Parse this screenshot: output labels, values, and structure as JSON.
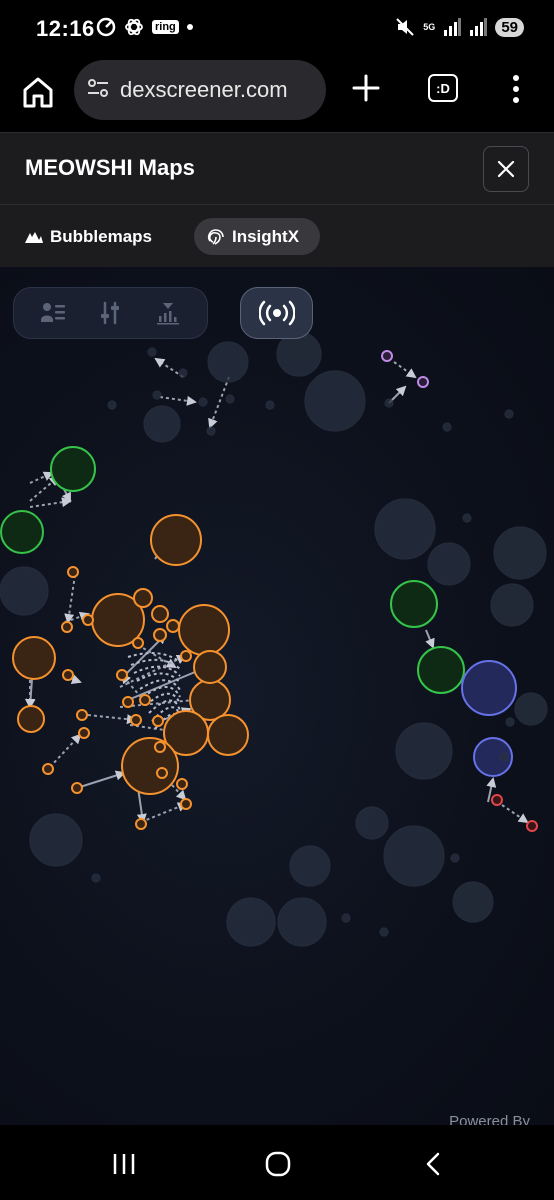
{
  "status": {
    "time": "12:16",
    "ring_label": "ring",
    "network": "5G",
    "battery": "59"
  },
  "browser": {
    "url": "dexscreener.com",
    "tabs_label": ":D"
  },
  "header": {
    "title": "MEOWSHI Maps"
  },
  "source_tabs": [
    {
      "label": "Bubblemaps",
      "icon": "bubblemaps-logo-icon",
      "active": false
    },
    {
      "label": "InsightX",
      "icon": "insightx-fingerprint-icon",
      "active": true
    }
  ],
  "map": {
    "powered_by": "Powered By",
    "colors": {
      "orange": "#f5922e",
      "orange_fill": "#3a2414",
      "green": "#35c34a",
      "green_fill": "#0f2a14",
      "blue": "#6672e8",
      "blue_fill": "#23295a",
      "purple": "#c08ae6",
      "red": "#e0464a",
      "gray": "#283040",
      "link": "#9aa2b2"
    }
  },
  "nav": {
    "recent": "recent-apps-icon",
    "home": "home-circle-icon",
    "back": "back-chevron-icon"
  }
}
